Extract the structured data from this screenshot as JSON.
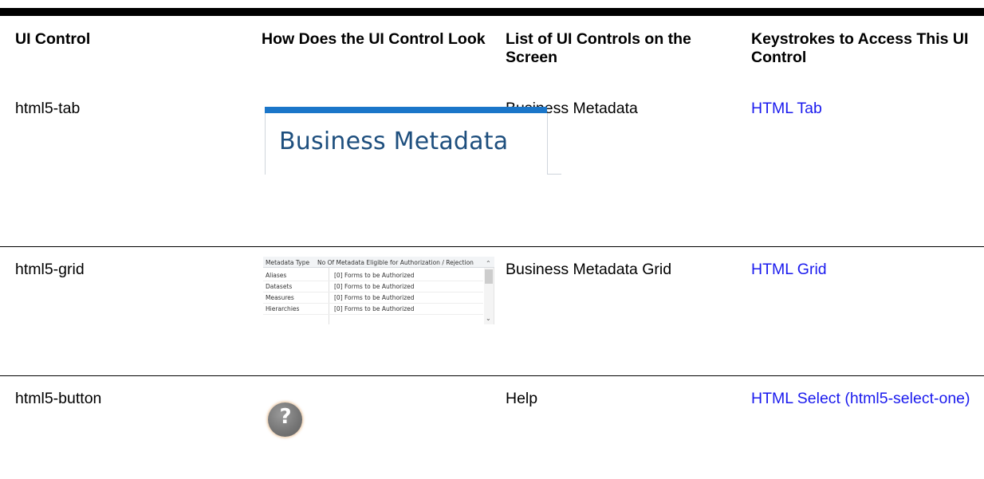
{
  "table": {
    "headers": [
      "UI Control",
      "How Does the UI Control Look",
      "List of UI Controls on the Screen",
      "Keystrokes to Access This UI Control"
    ],
    "rows": [
      {
        "control": "html5-tab",
        "screen_controls": "Business Metadata",
        "keystrokes_link": "HTML Tab"
      },
      {
        "control": "html5-grid",
        "screen_controls": "Business Metadata Grid",
        "keystrokes_link": "HTML Grid"
      },
      {
        "control": "html5-button",
        "screen_controls": "Help",
        "keystrokes_link": "HTML Select (html5-select-one)"
      }
    ]
  },
  "tab_preview": {
    "label": "Business Metadata",
    "accent_color": "#1b76c9"
  },
  "grid_preview": {
    "columns": [
      "Metadata Type",
      "No Of Metadata Eligible for Authorization / Rejection"
    ],
    "rows": [
      [
        "Aliases",
        "[0] Forms to be Authorized"
      ],
      [
        "Datasets",
        "[0] Forms to be Authorized"
      ],
      [
        "Measures",
        "[0] Forms to be Authorized"
      ],
      [
        "Hierarchies",
        "[0] Forms to be Authorized"
      ]
    ]
  },
  "help_preview": {
    "icon": "help-question-icon",
    "glyph": "?"
  },
  "colors": {
    "link": "#1a1aee",
    "rule": "#000000"
  }
}
